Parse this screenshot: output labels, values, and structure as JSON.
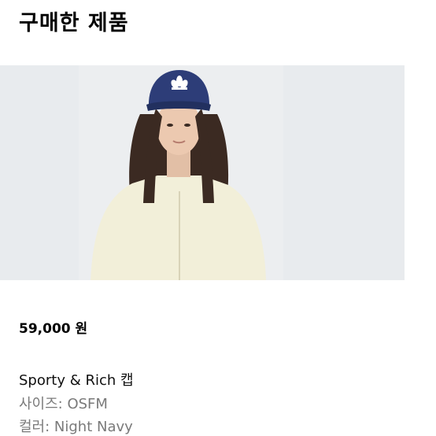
{
  "section": {
    "title": "구매한 제품"
  },
  "product": {
    "image_alt": "product photo",
    "price": "59,000 원",
    "name": "Sporty & Rich 캡",
    "size": "사이즈: OSFM",
    "color": "컬러: Night Navy"
  }
}
